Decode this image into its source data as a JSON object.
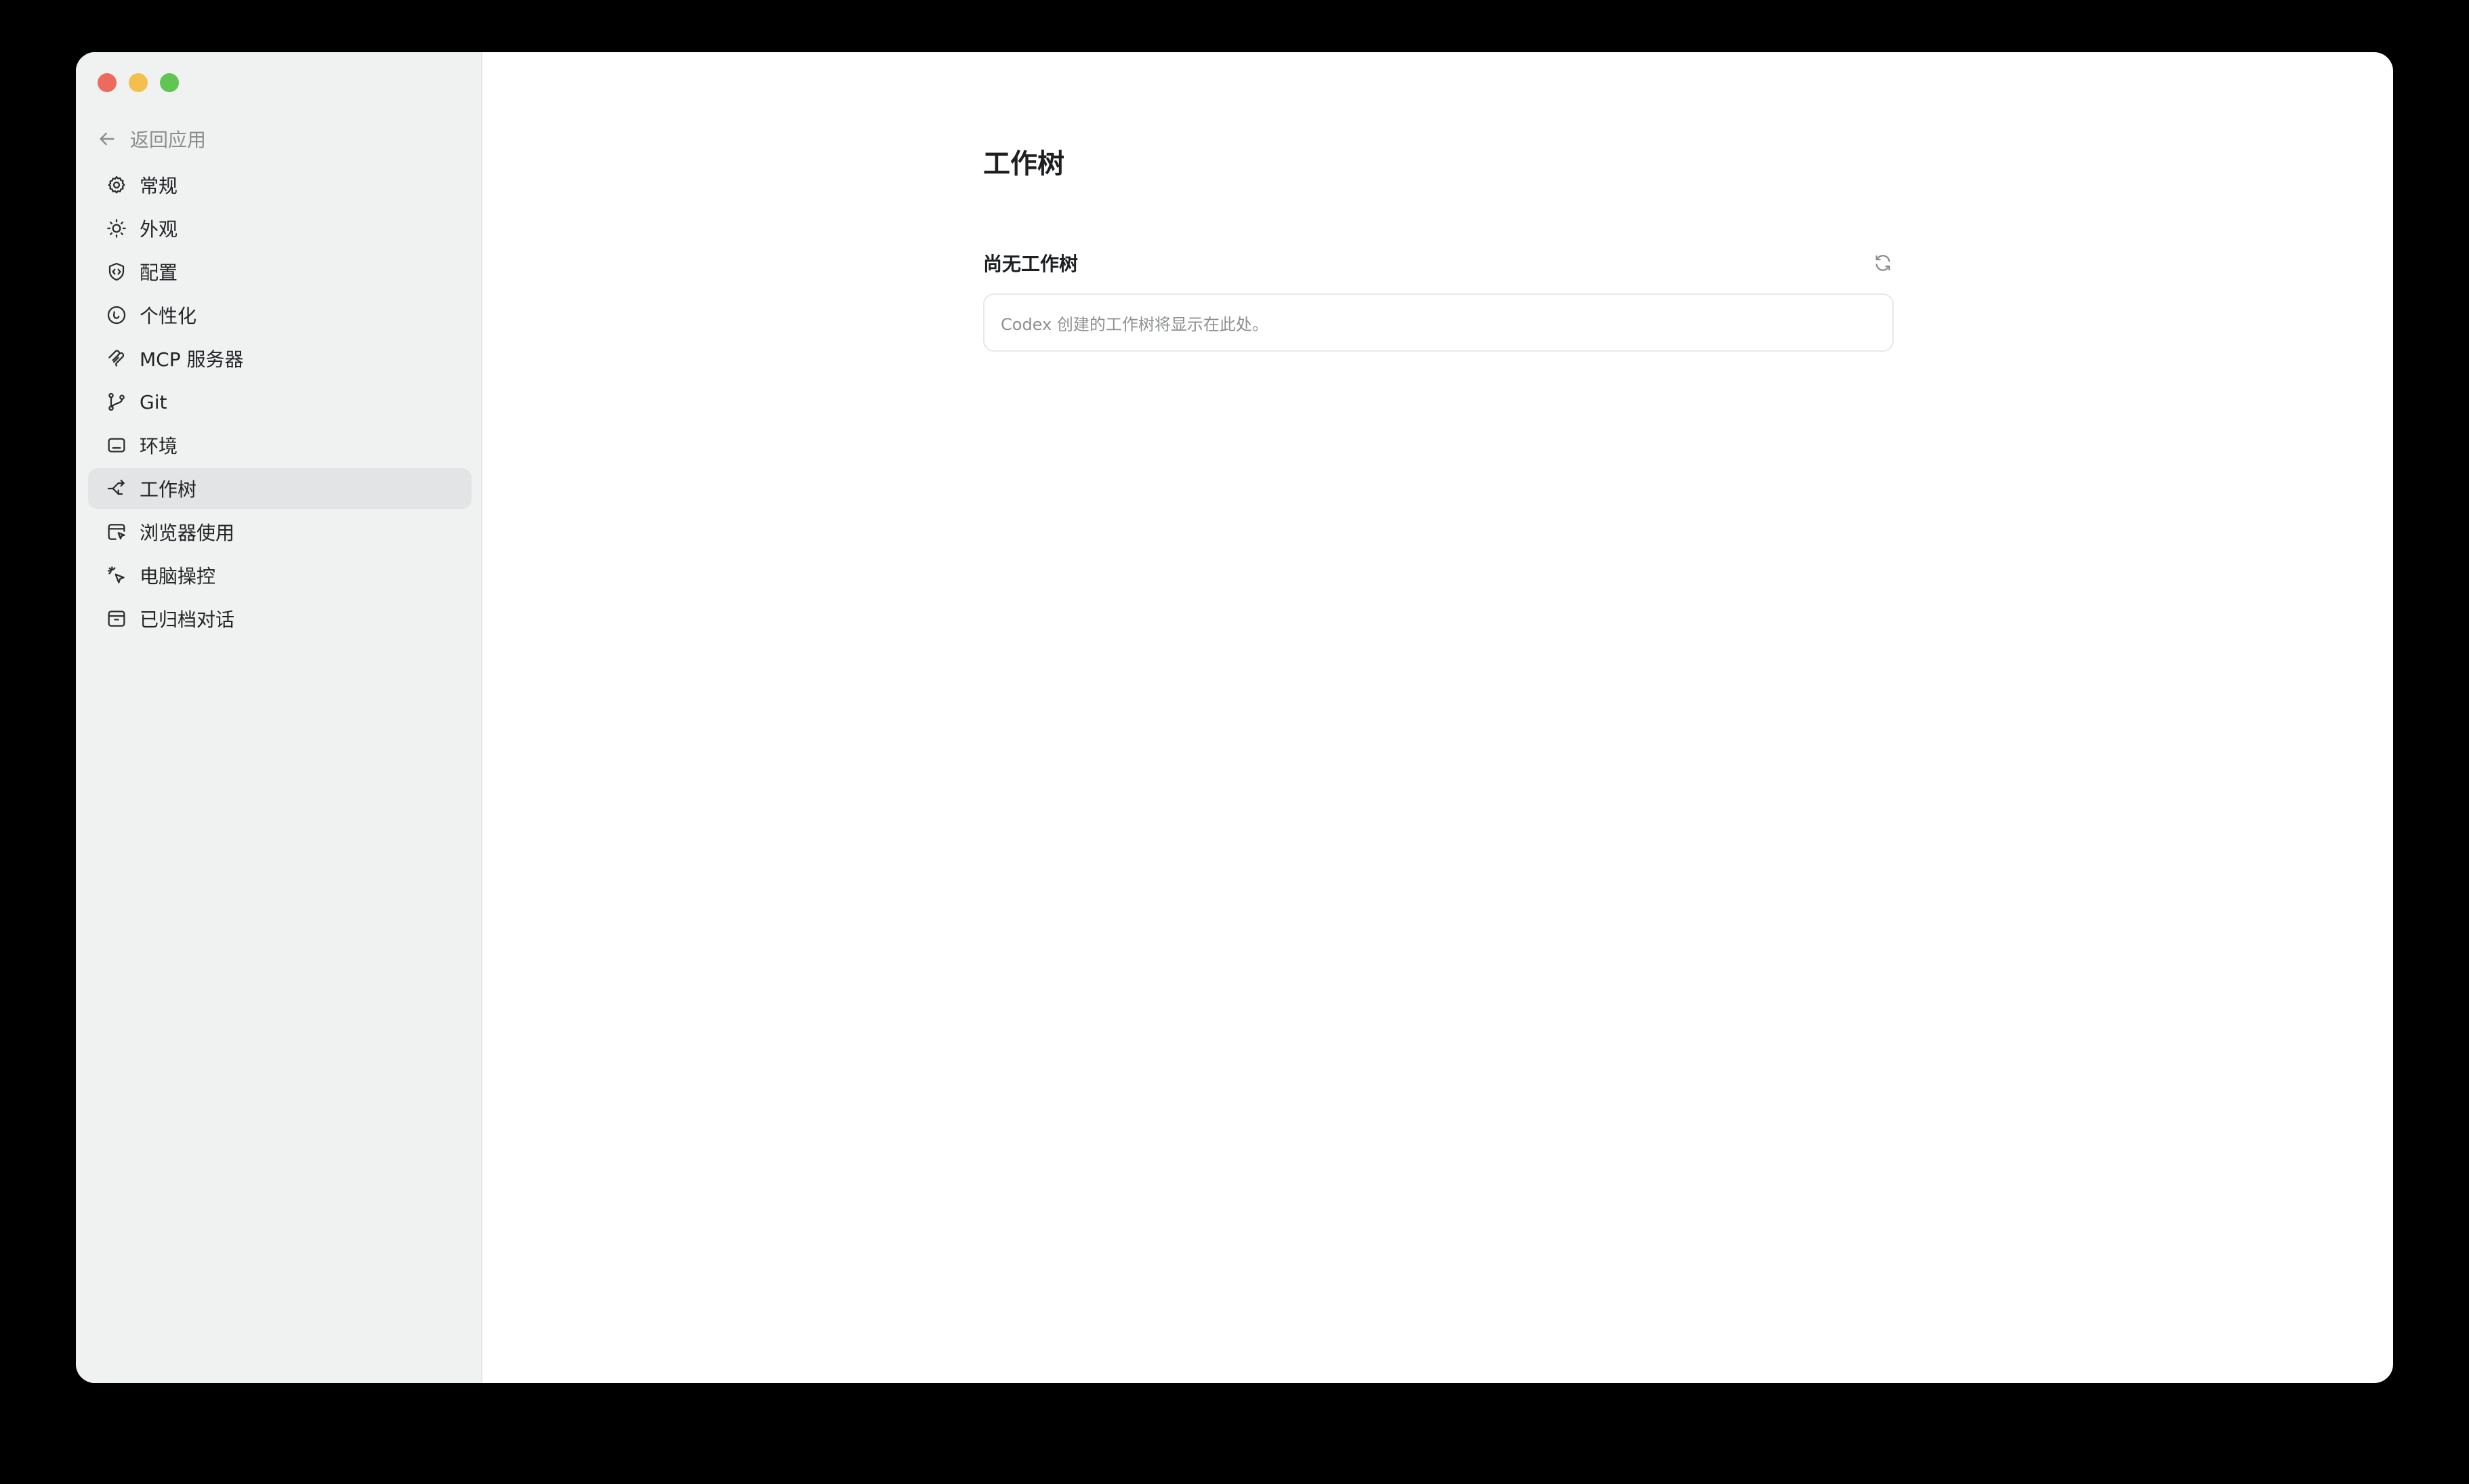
{
  "sidebar": {
    "back_label": "返回应用",
    "items": [
      {
        "label": "常规",
        "icon": "gear-icon",
        "active": false
      },
      {
        "label": "外观",
        "icon": "sun-icon",
        "active": false
      },
      {
        "label": "配置",
        "icon": "shield-code-icon",
        "active": false
      },
      {
        "label": "个性化",
        "icon": "smile-icon",
        "active": false
      },
      {
        "label": "MCP 服务器",
        "icon": "mcp-icon",
        "active": false
      },
      {
        "label": "Git",
        "icon": "git-branch-icon",
        "active": false
      },
      {
        "label": "环境",
        "icon": "terminal-icon",
        "active": false
      },
      {
        "label": "工作树",
        "icon": "worktree-icon",
        "active": true
      },
      {
        "label": "浏览器使用",
        "icon": "browser-cursor-icon",
        "active": false
      },
      {
        "label": "电脑操控",
        "icon": "pointer-sparkle-icon",
        "active": false
      },
      {
        "label": "已归档对话",
        "icon": "archive-icon",
        "active": false
      }
    ]
  },
  "main": {
    "title": "工作树",
    "section_title": "尚无工作树",
    "empty_message": "Codex 创建的工作树将显示在此处。"
  },
  "colors": {
    "sidebar_bg": "#f0f1f1",
    "active_item_bg": "#e3e4e5",
    "traffic_red": "#ed6a5e",
    "traffic_yellow": "#f4bf4f",
    "traffic_green": "#61c554"
  }
}
